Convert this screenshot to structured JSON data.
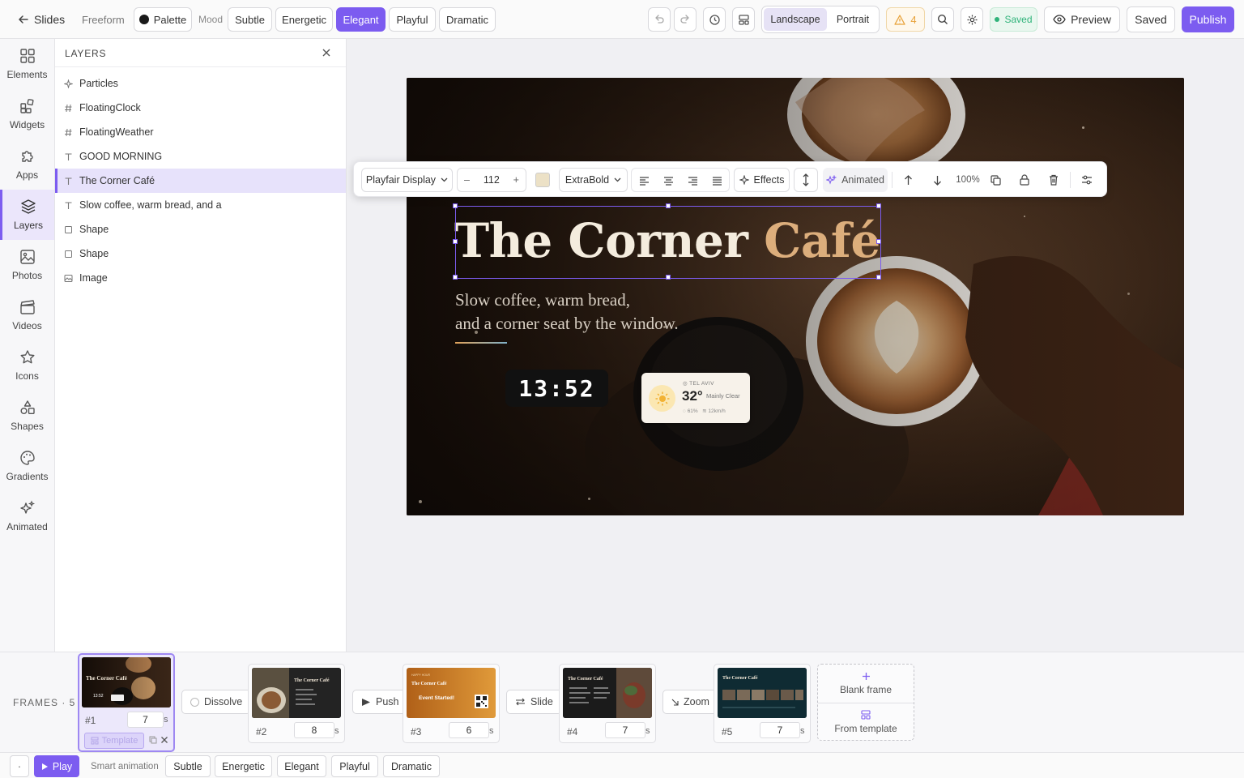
{
  "topbar": {
    "back_label": "Slides",
    "freeform_label": "Freeform",
    "palette_label": "Palette",
    "mood_label": "Mood",
    "moods": [
      "Subtle",
      "Energetic",
      "Elegant",
      "Playful",
      "Dramatic"
    ],
    "active_mood": "Elegant",
    "orientation": [
      "Landscape",
      "Portrait"
    ],
    "active_orientation": "Landscape",
    "warning_count": "4",
    "saved_status": "Saved",
    "preview_label": "Preview",
    "saved_button_label": "Saved",
    "publish_label": "Publish"
  },
  "rail": {
    "items": [
      {
        "label": "Elements",
        "icon": "grid-icon"
      },
      {
        "label": "Widgets",
        "icon": "widgets-icon"
      },
      {
        "label": "Apps",
        "icon": "puzzle-icon"
      },
      {
        "label": "Layers",
        "icon": "layers-icon"
      },
      {
        "label": "Photos",
        "icon": "photo-icon"
      },
      {
        "label": "Videos",
        "icon": "clapper-icon"
      },
      {
        "label": "Icons",
        "icon": "star-icon"
      },
      {
        "label": "Shapes",
        "icon": "shapes-icon"
      },
      {
        "label": "Gradients",
        "icon": "palette-icon"
      },
      {
        "label": "Animated",
        "icon": "sparkles-icon"
      }
    ],
    "active": "Layers"
  },
  "layers_panel": {
    "title": "LAYERS",
    "items": [
      {
        "label": "Particles",
        "icon": "sparkle-icon"
      },
      {
        "label": "FloatingClock",
        "icon": "hash-icon"
      },
      {
        "label": "FloatingWeather",
        "icon": "hash-icon"
      },
      {
        "label": "GOOD MORNING",
        "icon": "text-icon"
      },
      {
        "label": "The Corner Café",
        "icon": "text-icon"
      },
      {
        "label": "Slow coffee, warm bread, and a",
        "icon": "text-icon"
      },
      {
        "label": "Shape",
        "icon": "square-icon"
      },
      {
        "label": "Shape",
        "icon": "square-icon"
      },
      {
        "label": "Image",
        "icon": "image-icon"
      }
    ],
    "selected_index": 4
  },
  "text_toolbar": {
    "font_family": "Playfair Display",
    "font_size": "112",
    "minus": "–",
    "plus": "+",
    "color": "#ece1c6",
    "weight": "ExtraBold",
    "effects_label": "Effects",
    "animated_label": "Animated",
    "opacity": "100%"
  },
  "slide": {
    "title_part1": "The Corner ",
    "title_part2": "Café",
    "subtitle_line1": "Slow coffee, warm bread,",
    "subtitle_line2": "and a corner seat by the window.",
    "clock": "13:52",
    "weather": {
      "city": "TEL AVIV",
      "temp": "32°",
      "condition": "Mainly Clear",
      "humidity": "61%",
      "wind": "12km/h"
    }
  },
  "frames": {
    "label": "FRAMES · 5",
    "items": [
      {
        "num": "#1",
        "duration": "7",
        "unit": "s"
      },
      {
        "num": "#2",
        "duration": "8",
        "unit": "s"
      },
      {
        "num": "#3",
        "duration": "6",
        "unit": "s"
      },
      {
        "num": "#4",
        "duration": "7",
        "unit": "s"
      },
      {
        "num": "#5",
        "duration": "7",
        "unit": "s"
      }
    ],
    "transitions": [
      "Dissolve",
      "Push",
      "Slide",
      "Zoom"
    ],
    "template_label": "Template",
    "blank_frame_label": "Blank frame",
    "from_template_label": "From template",
    "thumb_texts": {
      "t1": "The Corner Café",
      "t1_clock": "13:52",
      "t2": "The Corner Café",
      "t3_small": "HAPPY HOUR",
      "t3": "The Corner Café",
      "t3_event": "Event Started!",
      "t4": "The Corner Café",
      "t5": "The Corner Café"
    }
  },
  "bottombar": {
    "dot": "·",
    "play_label": "Play",
    "smart_label": "Smart animation",
    "moods": [
      "Subtle",
      "Energetic",
      "Elegant",
      "Playful",
      "Dramatic"
    ]
  },
  "colors": {
    "accent": "#7c5cf0",
    "saved_green": "#2fb37a",
    "warning": "#e8a23a"
  }
}
